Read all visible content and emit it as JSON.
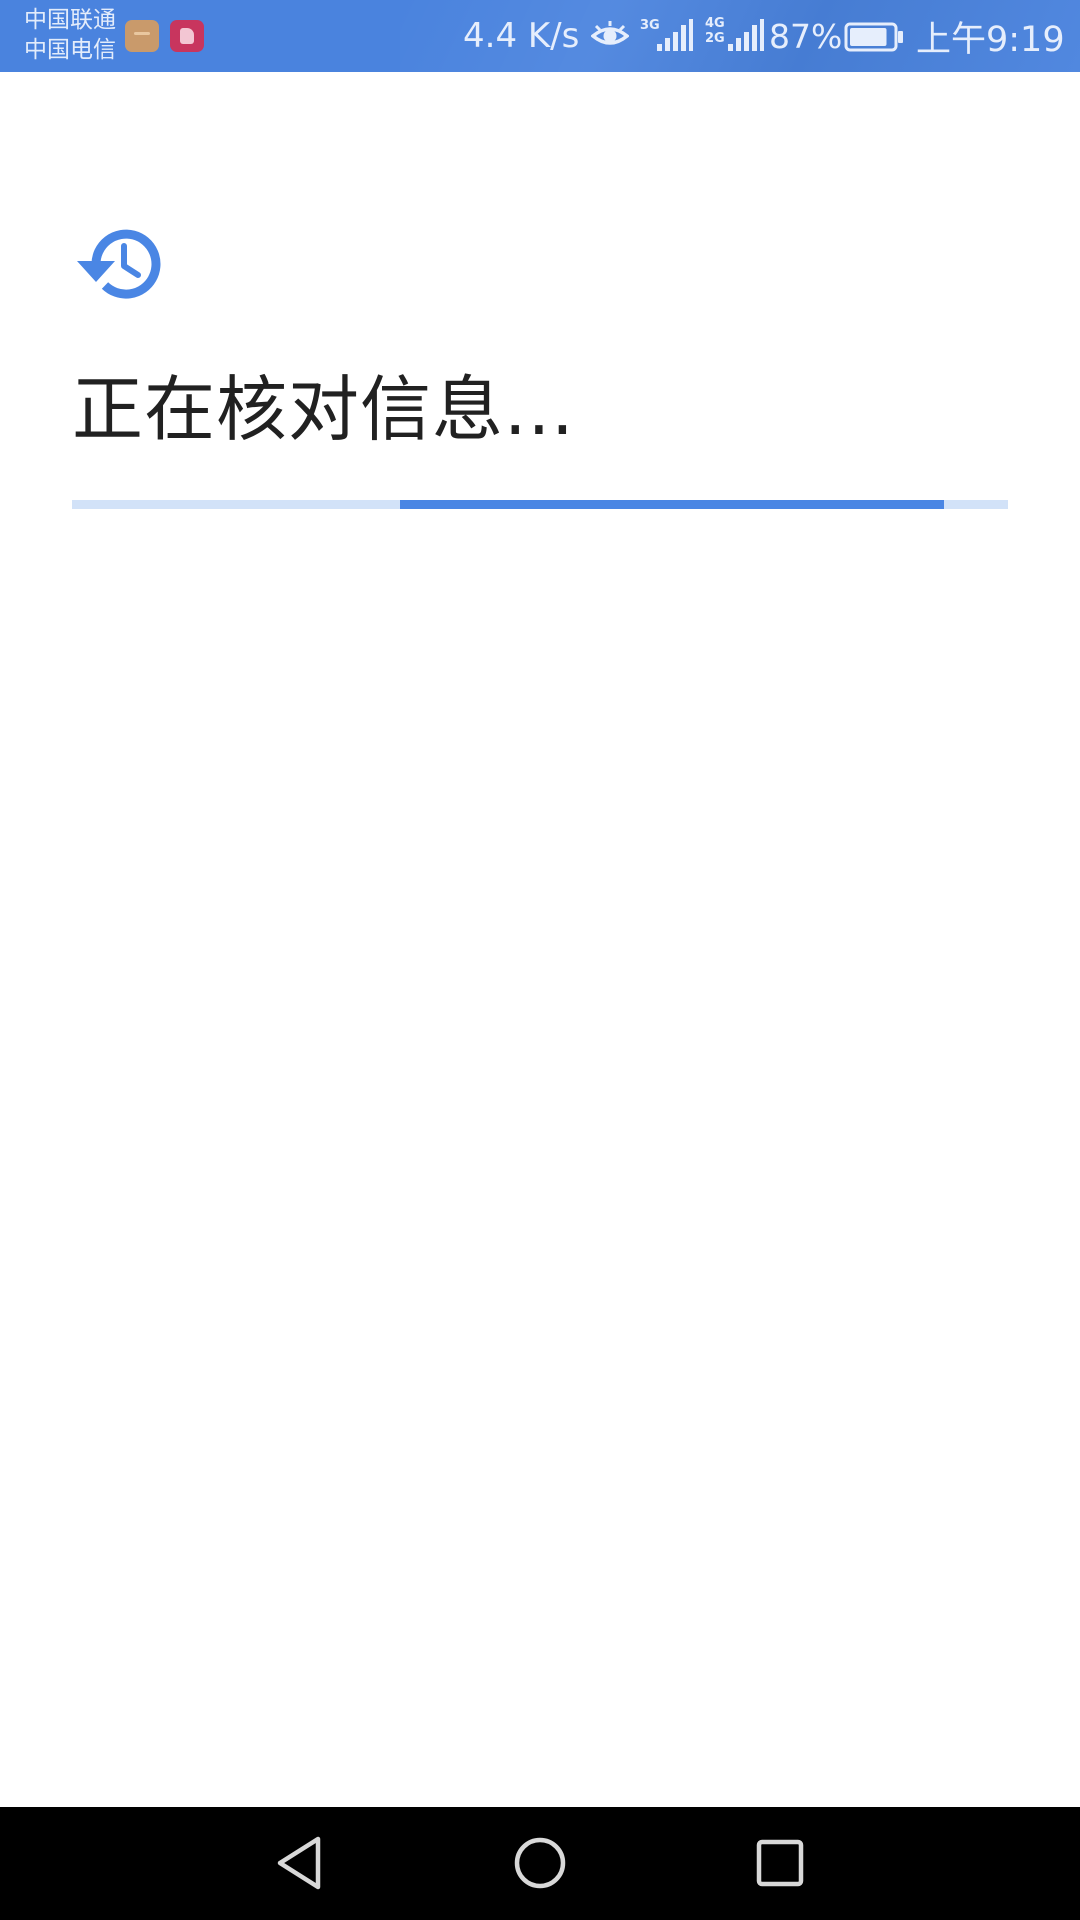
{
  "status_bar": {
    "carrier_1": "中国联通",
    "carrier_2": "中国电信",
    "net_speed": "4.4 K/s",
    "signal_1_label": "3G",
    "signal_2_label_top": "4G",
    "signal_2_label_bottom": "2G",
    "battery_percent": "87%",
    "battery_level": 0.87,
    "time": "上午9:19",
    "background_color": "#4a83de",
    "icons": [
      "app-notification-icon",
      "app-notification-icon",
      "eye-icon",
      "signal-3g-icon",
      "signal-4g-icon",
      "battery-icon"
    ]
  },
  "main": {
    "icon": "history-icon",
    "title": "正在核对信息...",
    "accent_color": "#4a86e4",
    "progress_track_color": "#d2e2f8"
  },
  "nav_bar": {
    "icons": [
      "back-icon",
      "home-icon",
      "recents-icon"
    ]
  }
}
